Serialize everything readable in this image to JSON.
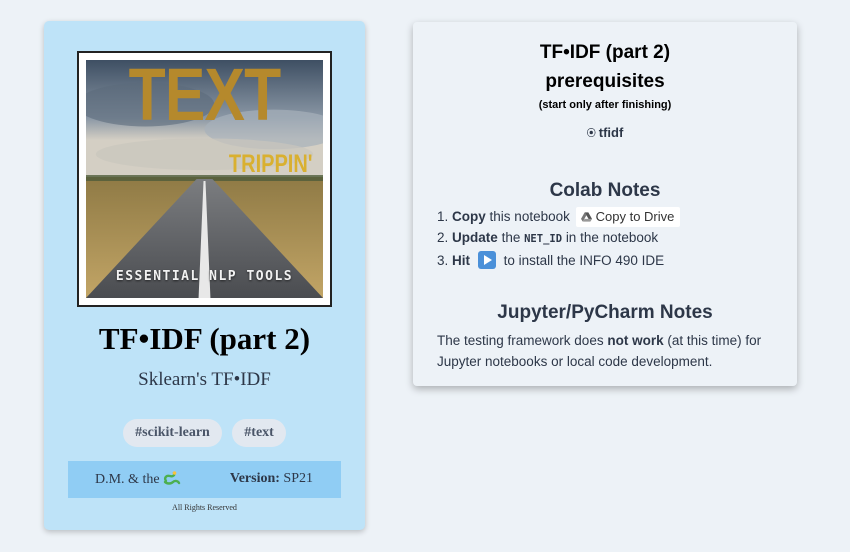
{
  "card": {
    "cover": {
      "title": "TEXT",
      "subtitle": "TRIPPIN'",
      "footer": "ESSENTIAL NLP TOOLS"
    },
    "title": "TF•IDF (part 2)",
    "subtitle": "Sklearn's TF•IDF",
    "tags": [
      "#scikit-learn",
      "#text"
    ],
    "footer": {
      "author": "D.M. & the",
      "author_icon": "snake-icon",
      "version_label": "Version:",
      "version_value": "SP21"
    },
    "rights": "All Rights Reserved"
  },
  "panel": {
    "title": "TF•IDF (part 2)",
    "prereq_heading": "prerequisites",
    "prereq_note": "(start only after finishing)",
    "prereq_items": [
      "tfidf"
    ],
    "colab_heading": "Colab Notes",
    "colab_steps": {
      "s1_num": "1.",
      "s1_bold": "Copy",
      "s1_text": "this notebook",
      "s1_button": "Copy to Drive",
      "s2_num": "2.",
      "s2_bold": "Update",
      "s2_pre": "the",
      "s2_code": "NET_ID",
      "s2_post": "in the notebook",
      "s3_num": "3.",
      "s3_bold": "Hit",
      "s3_icon": "play-button-icon",
      "s3_text": "to install the INFO 490 IDE"
    },
    "jupyter_heading": "Jupyter/PyCharm Notes",
    "jupyter": {
      "pre": "The testing framework does",
      "bold": "not work",
      "post": "(at this time) for Jupyter notebooks or local code development."
    }
  },
  "colors": {
    "page_bg": "#edf2f7",
    "card_bg": "#bee3f8",
    "footer_bg": "#90cdf4",
    "tag_bg": "#e2e8f0",
    "text_dark": "#2d3748",
    "play_blue": "#4a90d9"
  }
}
